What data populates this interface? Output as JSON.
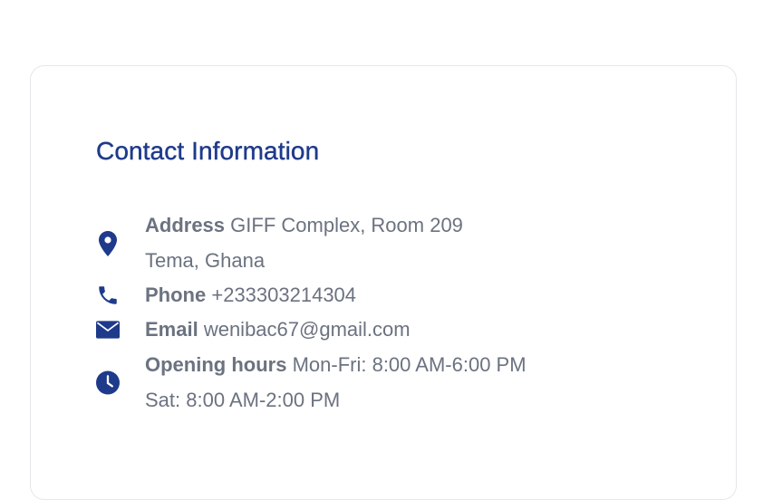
{
  "title": "Contact Information",
  "accent_color": "#1e3a8a",
  "text_color": "#6b7280",
  "items": [
    {
      "icon": "map-pin-icon",
      "label": "Address",
      "lines": [
        "GIFF Complex, Room 209",
        "Tema, Ghana"
      ]
    },
    {
      "icon": "phone-icon",
      "label": "Phone",
      "lines": [
        "+233303214304"
      ]
    },
    {
      "icon": "envelope-icon",
      "label": "Email",
      "lines": [
        "wenibac67@gmail.com"
      ]
    },
    {
      "icon": "clock-icon",
      "label": "Opening hours",
      "lines": [
        "Mon-Fri: 8:00 AM-6:00 PM",
        "Sat: 8:00 AM-2:00 PM"
      ]
    }
  ]
}
